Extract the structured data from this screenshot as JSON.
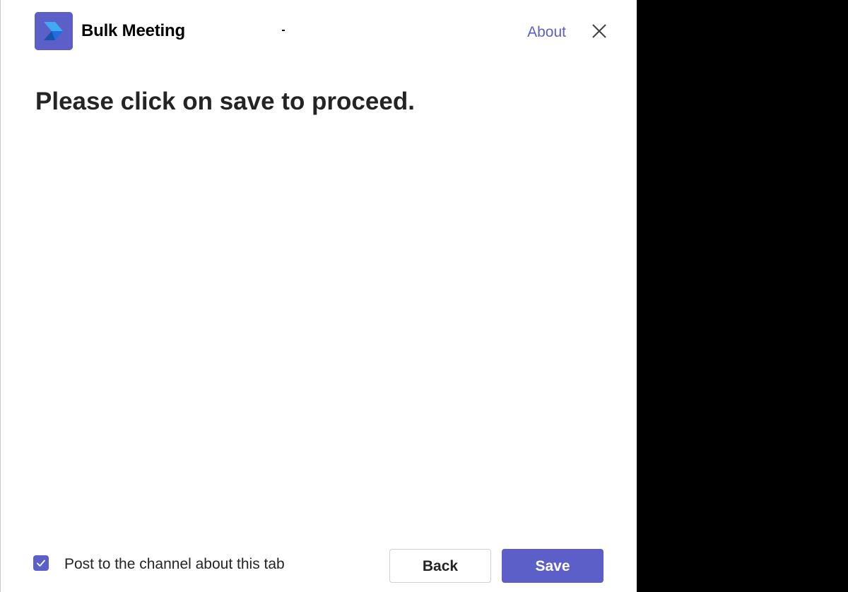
{
  "app": {
    "name": "Bulk Meeting",
    "logo_icon": "bulk-meeting-logo-icon",
    "brand_color": "#5b5fc7"
  },
  "header": {
    "about_label": "About",
    "close_icon": "close-icon"
  },
  "main": {
    "headline": "Please click on save to proceed."
  },
  "footer": {
    "post_to_channel": {
      "label": "Post to the channel about this tab",
      "checked": true
    },
    "back_label": "Back",
    "save_label": "Save"
  }
}
